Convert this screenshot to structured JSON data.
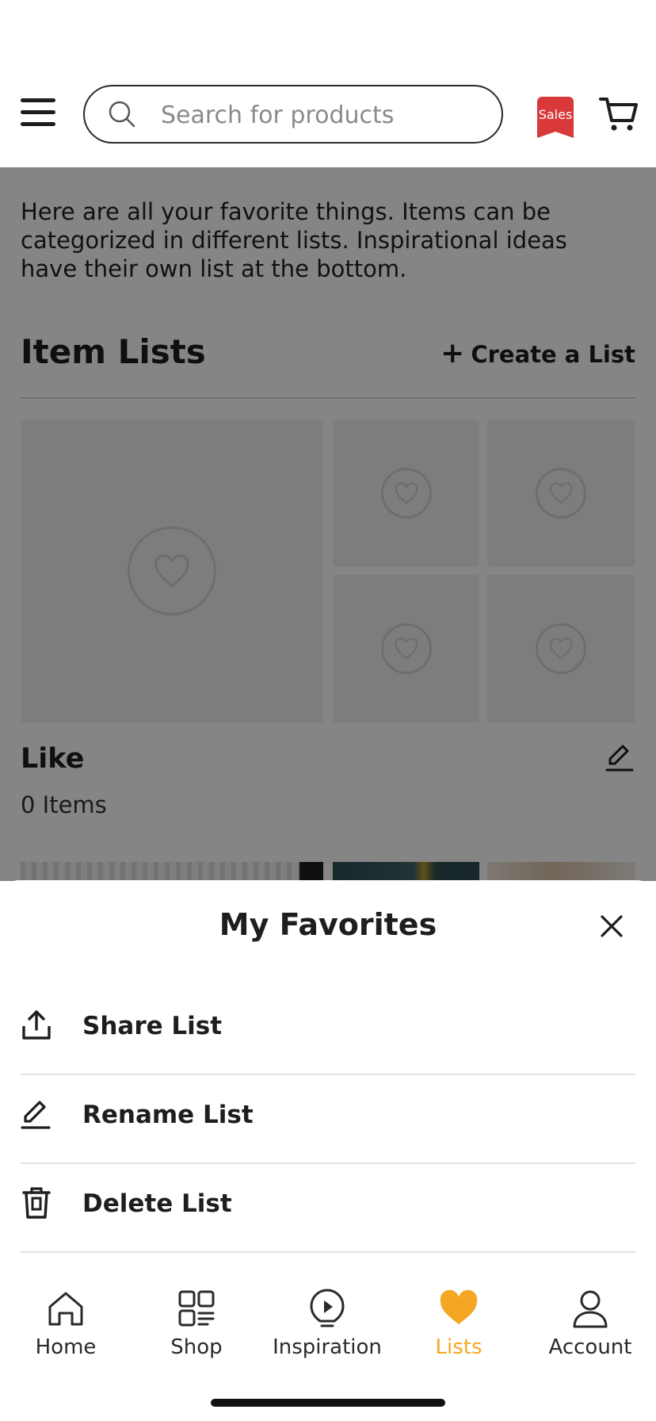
{
  "header": {
    "search_placeholder": "Search for products",
    "sales_badge": "Sales"
  },
  "page": {
    "intro": "Here are all your favorite things. Items can be categorized in different lists. Inspirational ideas have their own list at the bottom.",
    "section_title": "Item Lists",
    "create_list_plus": "+",
    "create_list_label": "Create a List",
    "list": {
      "name": "Like",
      "count": "0 Items"
    }
  },
  "sheet": {
    "title": "My Favorites",
    "actions": [
      {
        "label": "Share List",
        "icon": "share-icon"
      },
      {
        "label": "Rename List",
        "icon": "pencil-icon"
      },
      {
        "label": "Delete List",
        "icon": "trash-icon"
      }
    ]
  },
  "tabbar": {
    "items": [
      {
        "label": "Home",
        "icon": "home-icon"
      },
      {
        "label": "Shop",
        "icon": "grid-icon"
      },
      {
        "label": "Inspiration",
        "icon": "lightbulb-icon"
      },
      {
        "label": "Lists",
        "icon": "heart-icon",
        "active": true
      },
      {
        "label": "Account",
        "icon": "person-icon"
      }
    ],
    "active_color": "#f5a623"
  },
  "colors": {
    "sales_badge": "#d9393a",
    "accent": "#f5a623"
  }
}
